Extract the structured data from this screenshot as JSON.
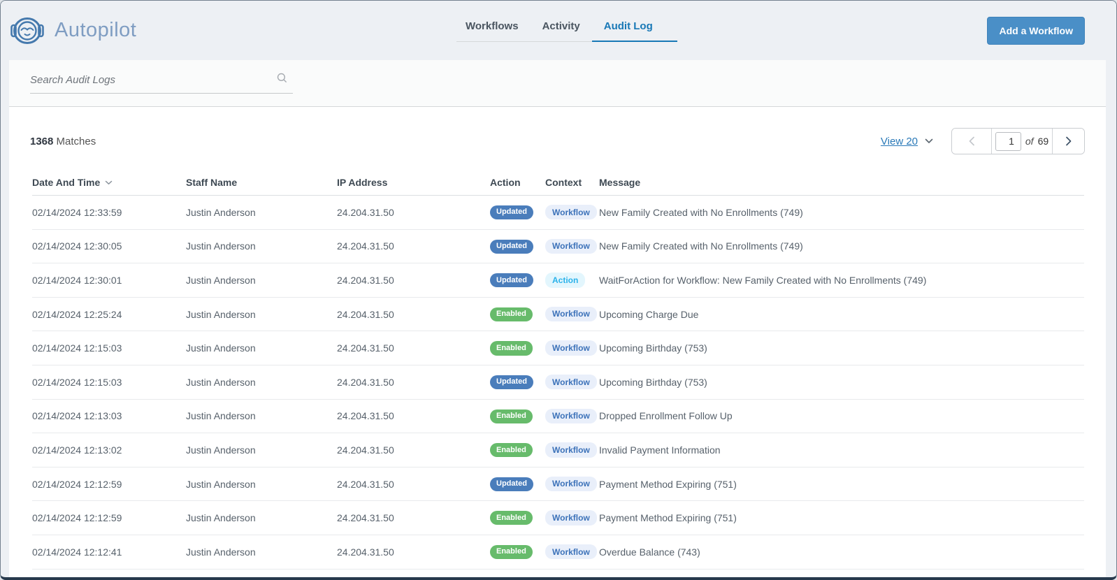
{
  "header": {
    "app_title": "Autopilot",
    "tabs": [
      {
        "label": "Workflows",
        "active": false
      },
      {
        "label": "Activity",
        "active": false
      },
      {
        "label": "Audit Log",
        "active": true
      }
    ],
    "add_button_label": "Add a Workflow"
  },
  "search": {
    "placeholder": "Search Audit Logs",
    "value": ""
  },
  "results": {
    "match_count": "1368",
    "matches_label": "Matches",
    "view_label": "View 20",
    "pager": {
      "current_page": "1",
      "of_label": "of",
      "total_pages": "69"
    }
  },
  "table": {
    "columns": [
      "Date And Time",
      "Staff Name",
      "IP Address",
      "Action",
      "Context",
      "Message"
    ],
    "rows": [
      {
        "date": "02/14/2024 12:33:59",
        "staff": "Justin Anderson",
        "ip": "24.204.31.50",
        "action": "Updated",
        "context": "Workflow",
        "message": "New Family Created with No Enrollments (749)"
      },
      {
        "date": "02/14/2024 12:30:05",
        "staff": "Justin Anderson",
        "ip": "24.204.31.50",
        "action": "Updated",
        "context": "Workflow",
        "message": "New Family Created with No Enrollments (749)"
      },
      {
        "date": "02/14/2024 12:30:01",
        "staff": "Justin Anderson",
        "ip": "24.204.31.50",
        "action": "Updated",
        "context": "Action",
        "message": "WaitForAction for Workflow: New Family Created with No Enrollments (749)"
      },
      {
        "date": "02/14/2024 12:25:24",
        "staff": "Justin Anderson",
        "ip": "24.204.31.50",
        "action": "Enabled",
        "context": "Workflow",
        "message": "Upcoming Charge Due"
      },
      {
        "date": "02/14/2024 12:15:03",
        "staff": "Justin Anderson",
        "ip": "24.204.31.50",
        "action": "Enabled",
        "context": "Workflow",
        "message": "Upcoming Birthday (753)"
      },
      {
        "date": "02/14/2024 12:15:03",
        "staff": "Justin Anderson",
        "ip": "24.204.31.50",
        "action": "Updated",
        "context": "Workflow",
        "message": "Upcoming Birthday (753)"
      },
      {
        "date": "02/14/2024 12:13:03",
        "staff": "Justin Anderson",
        "ip": "24.204.31.50",
        "action": "Enabled",
        "context": "Workflow",
        "message": "Dropped Enrollment Follow Up"
      },
      {
        "date": "02/14/2024 12:13:02",
        "staff": "Justin Anderson",
        "ip": "24.204.31.50",
        "action": "Enabled",
        "context": "Workflow",
        "message": "Invalid Payment Information"
      },
      {
        "date": "02/14/2024 12:12:59",
        "staff": "Justin Anderson",
        "ip": "24.204.31.50",
        "action": "Updated",
        "context": "Workflow",
        "message": "Payment Method Expiring (751)"
      },
      {
        "date": "02/14/2024 12:12:59",
        "staff": "Justin Anderson",
        "ip": "24.204.31.50",
        "action": "Enabled",
        "context": "Workflow",
        "message": "Payment Method Expiring (751)"
      },
      {
        "date": "02/14/2024 12:12:41",
        "staff": "Justin Anderson",
        "ip": "24.204.31.50",
        "action": "Enabled",
        "context": "Workflow",
        "message": "Overdue Balance (743)"
      }
    ]
  },
  "colors": {
    "accent_blue": "#1878b6",
    "button_blue": "#4a8fc7",
    "badge_updated": "#4a7dbb",
    "badge_enabled": "#67bb6b",
    "context_workflow_bg": "#e9effa",
    "context_workflow_text": "#3c72b9",
    "context_action_bg": "#e3f6fd",
    "context_action_text": "#2ab2ea"
  }
}
